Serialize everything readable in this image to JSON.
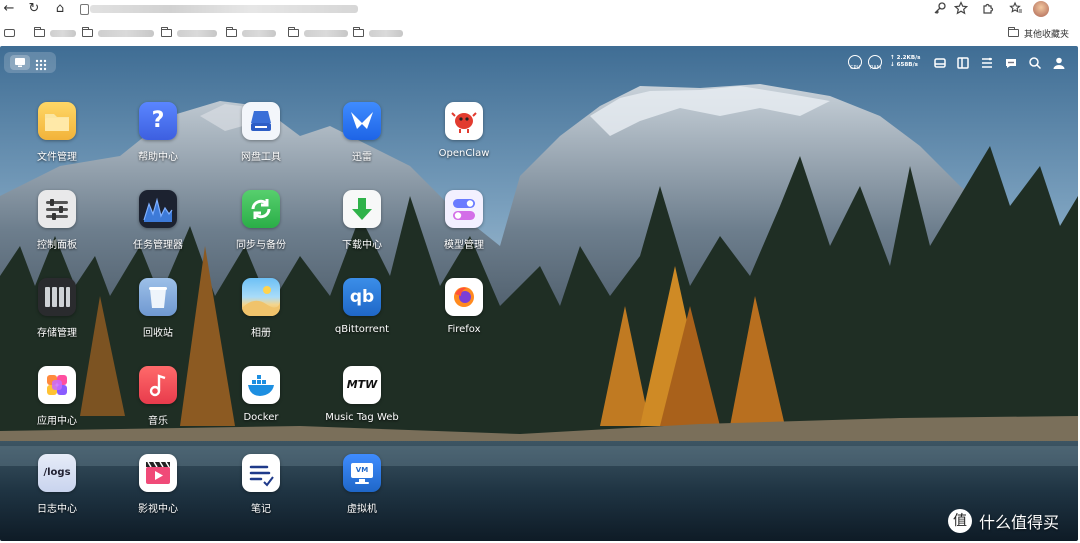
{
  "browser": {
    "nav": {
      "back": "←",
      "reload": "↻",
      "home": "⌂"
    },
    "right_icons": [
      "key-icon",
      "star-icon",
      "extensions-icon",
      "favorites-icon"
    ],
    "bookmarks_other": "其他收藏夹"
  },
  "desktop": {
    "status": {
      "cpu_label": "CPU",
      "ram_label": "RAM",
      "upload": "↑ 2.2KB/s",
      "download": "↓ 658B/s"
    },
    "apps": [
      {
        "label": "文件管理"
      },
      {
        "label": "帮助中心"
      },
      {
        "label": "网盘工具"
      },
      {
        "label": "迅雷"
      },
      {
        "label": "OpenClaw"
      },
      {
        "label": "控制面板"
      },
      {
        "label": "任务管理器"
      },
      {
        "label": "同步与备份"
      },
      {
        "label": "下载中心"
      },
      {
        "label": "模型管理"
      },
      {
        "label": "存储管理"
      },
      {
        "label": "回收站"
      },
      {
        "label": "相册"
      },
      {
        "label": "qBittorrent"
      },
      {
        "label": "Firefox"
      },
      {
        "label": "应用中心"
      },
      {
        "label": "音乐"
      },
      {
        "label": "Docker"
      },
      {
        "label": "Music Tag Web"
      },
      {
        "label": "日志中心"
      },
      {
        "label": "影视中心"
      },
      {
        "label": "笔记"
      },
      {
        "label": "虚拟机"
      }
    ],
    "icon_texts": {
      "help": "?",
      "qb": "qb",
      "mtw": "MTW",
      "logs": "/logs",
      "vm": "VM"
    }
  },
  "watermark": {
    "logo": "值",
    "text": "什么值得买"
  }
}
